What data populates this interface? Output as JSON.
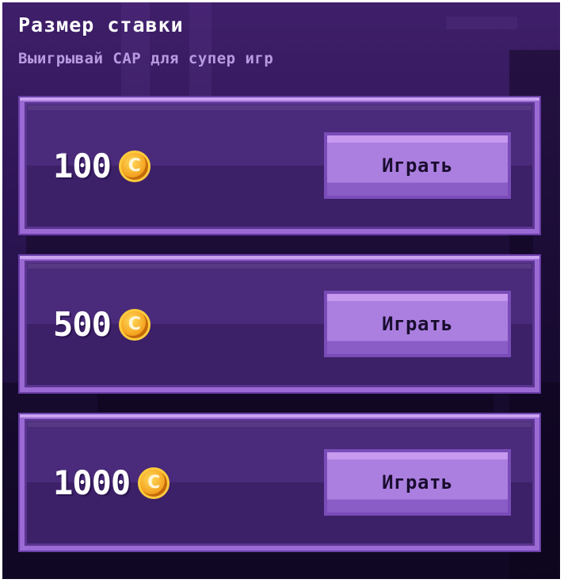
{
  "header": {
    "title": "Размер ставки",
    "subtitle": "Выигрывай CAP для супер игр"
  },
  "bets": [
    {
      "amount": "100",
      "button_label": "Играть"
    },
    {
      "amount": "500",
      "button_label": "Играть"
    },
    {
      "amount": "1000",
      "button_label": "Играть"
    }
  ],
  "icons": {
    "coin_symbol": "C",
    "coin_name": "coin-icon"
  },
  "colors": {
    "background": "#2d1555",
    "card": "#4a2a7a",
    "card_border": "#9b6ad4",
    "button": "#ab7fe0",
    "coin": "#f5a623",
    "subtitle": "#b79be0"
  }
}
